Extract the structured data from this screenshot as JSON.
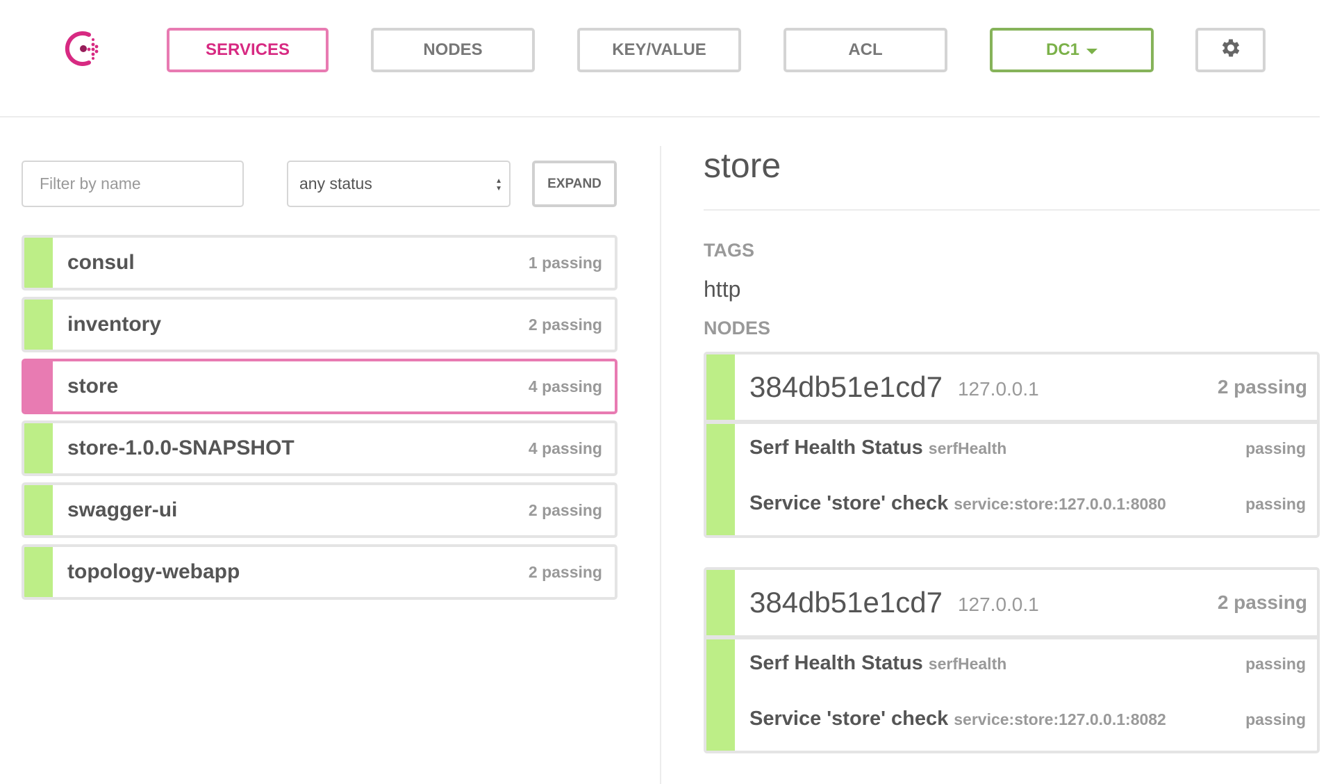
{
  "header": {
    "logo": "consul-logo",
    "nav": [
      {
        "label": "SERVICES",
        "active": true
      },
      {
        "label": "NODES",
        "active": false
      },
      {
        "label": "KEY/VALUE",
        "active": false
      },
      {
        "label": "ACL",
        "active": false
      }
    ],
    "datacenter": "DC1",
    "settings_icon": "gear-icon"
  },
  "filters": {
    "name_placeholder": "Filter by name",
    "name_value": "",
    "status_selected": "any status",
    "expand_label": "EXPAND"
  },
  "services": [
    {
      "name": "consul",
      "count": "1 passing",
      "selected": false
    },
    {
      "name": "inventory",
      "count": "2 passing",
      "selected": false
    },
    {
      "name": "store",
      "count": "4 passing",
      "selected": true
    },
    {
      "name": "store-1.0.0-SNAPSHOT",
      "count": "4 passing",
      "selected": false
    },
    {
      "name": "swagger-ui",
      "count": "2 passing",
      "selected": false
    },
    {
      "name": "topology-webapp",
      "count": "2 passing",
      "selected": false
    }
  ],
  "detail": {
    "title": "store",
    "tags_label": "TAGS",
    "tags": [
      "http"
    ],
    "nodes_label": "NODES",
    "nodes": [
      {
        "name": "384db51e1cd7",
        "address": "127.0.0.1",
        "count": "2 passing",
        "checks": [
          {
            "name": "Serf Health Status",
            "id": "serfHealth",
            "status": "passing"
          },
          {
            "name": "Service 'store' check",
            "id": "service:store:127.0.0.1:8080",
            "status": "passing"
          }
        ]
      },
      {
        "name": "384db51e1cd7",
        "address": "127.0.0.1",
        "count": "2 passing",
        "checks": [
          {
            "name": "Serf Health Status",
            "id": "serfHealth",
            "status": "passing"
          },
          {
            "name": "Service 'store' check",
            "id": "service:store:127.0.0.1:8082",
            "status": "passing"
          }
        ]
      }
    ]
  },
  "colors": {
    "brand": "#d72a82",
    "brand_border": "#e87bb2",
    "passing": "#bdee87",
    "datacenter": "#7bb149"
  }
}
